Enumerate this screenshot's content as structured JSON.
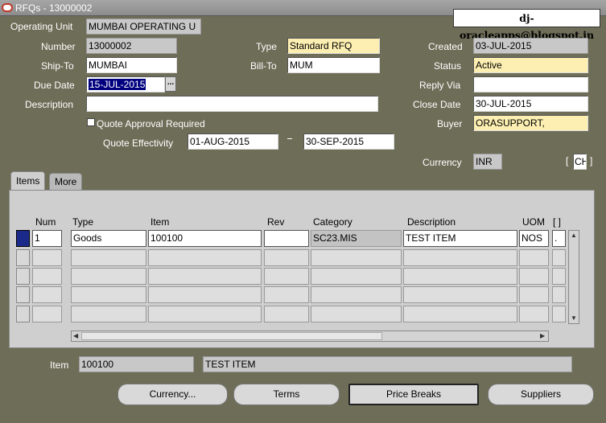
{
  "window": {
    "title": "RFQs - 13000002"
  },
  "watermark": "dj-oracleapps@blogspot.in",
  "header": {
    "operating_unit_label": "Operating Unit",
    "operating_unit": "MUMBAI OPERATING U",
    "number_label": "Number",
    "number": "13000002",
    "type_label": "Type",
    "type": "Standard RFQ",
    "created_label": "Created",
    "created": "03-JUL-2015",
    "ship_to_label": "Ship-To",
    "ship_to": "MUMBAI",
    "bill_to_label": "Bill-To",
    "bill_to": "MUM",
    "status_label": "Status",
    "status": "Active",
    "due_date_label": "Due Date",
    "due_date": "15-JUL-2015",
    "lov_glyph": "...",
    "reply_via_label": "Reply Via",
    "reply_via": "",
    "description_label": "Description",
    "description": "",
    "close_date_label": "Close Date",
    "close_date": "30-JUL-2015",
    "quote_approval_label": "Quote Approval Required",
    "buyer_label": "Buyer",
    "buyer": "ORASUPPORT,",
    "quote_effectivity_label": "Quote Effectivity",
    "effectivity_from": "01-AUG-2015",
    "effectivity_to": "30-SEP-2015",
    "currency_label": "Currency",
    "currency": "INR",
    "currency_extra": "CH"
  },
  "tabs": [
    {
      "label": "Items"
    },
    {
      "label": "More"
    }
  ],
  "table": {
    "columns": [
      "Num",
      "Type",
      "Item",
      "Rev",
      "Category",
      "Description",
      "UOM",
      "[ ]"
    ],
    "rows": [
      {
        "num": "1",
        "type": "Goods",
        "item": "100100",
        "rev": "",
        "category": "SC23.MIS",
        "description": "TEST ITEM",
        "uom": "NOS",
        "extra": "."
      }
    ]
  },
  "footer": {
    "item_label": "Item",
    "item": "100100",
    "item_description": "TEST ITEM"
  },
  "buttons": {
    "currency": "Currency...",
    "terms": "Terms",
    "price_breaks": "Price Breaks",
    "suppliers": "Suppliers"
  }
}
